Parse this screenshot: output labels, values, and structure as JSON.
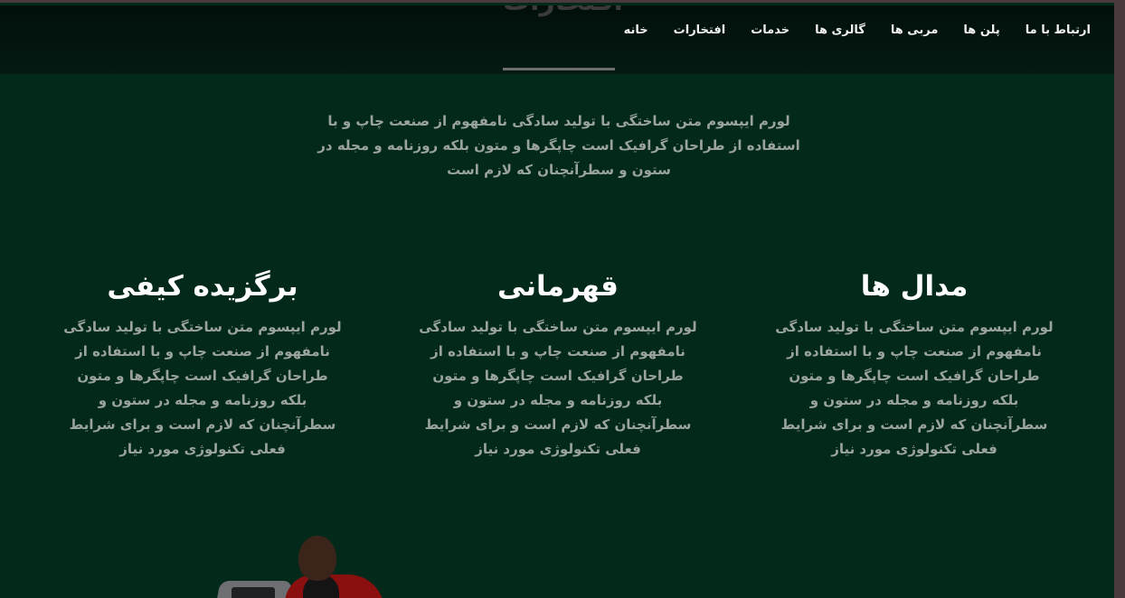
{
  "nav": {
    "items": [
      {
        "label": "خانه"
      },
      {
        "label": "افتخارات"
      },
      {
        "label": "خدمات"
      },
      {
        "label": "گالری ها"
      },
      {
        "label": "مربی ها"
      },
      {
        "label": "پلن ها"
      },
      {
        "label": "ارتباط با ما"
      }
    ]
  },
  "section": {
    "title": "افتخارات",
    "intro": "لورم ایپسوم متن ساختگی با تولید سادگی نامفهوم از صنعت چاپ و با استفاده از طراحان گرافیک است چاپگرها و متون بلکه روزنامه و مجله در ستون و سطرآنچنان که لازم است"
  },
  "features": [
    {
      "title": "مدال ها",
      "text": "لورم ایپسوم متن ساختگی با تولید سادگی نامفهوم از صنعت چاپ و با استفاده از طراحان گرافیک است چاپگرها و متون بلکه روزنامه و مجله در ستون و سطرآنچنان که لازم است و برای شرایط فعلی تکنولوژی مورد نیاز"
    },
    {
      "title": "قهرمانی",
      "text": "لورم ایپسوم متن ساختگی با تولید سادگی نامفهوم از صنعت چاپ و با استفاده از طراحان گرافیک است چاپگرها و متون بلکه روزنامه و مجله در ستون و سطرآنچنان که لازم است و برای شرایط فعلی تکنولوژی مورد نیاز"
    },
    {
      "title": "برگزیده کیفی",
      "text": "لورم ایپسوم متن ساختگی با تولید سادگی نامفهوم از صنعت چاپ و با استفاده از طراحان گرافیک است چاپگرها و متون بلکه روزنامه و مجله در ستون و سطرآنچنان که لازم است و برای شرایط فعلی تکنولوژی مورد نیاز"
    }
  ],
  "colors": {
    "background": "#03291b",
    "navbar": "#020f0a",
    "text_muted": "#9aa39e",
    "heading": "#ffffff"
  }
}
